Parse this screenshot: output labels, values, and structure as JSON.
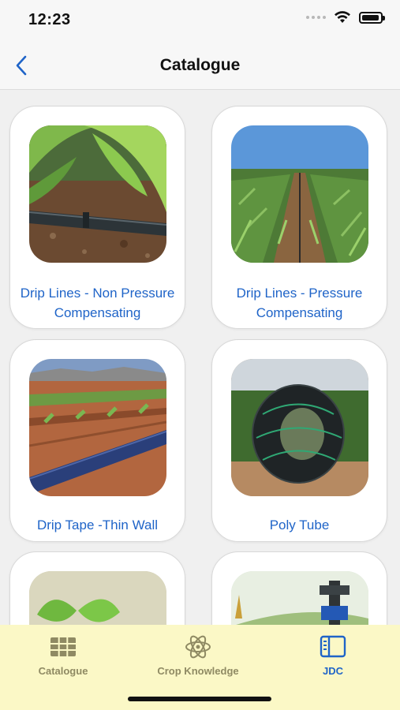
{
  "status_bar": {
    "time": "12:23"
  },
  "nav": {
    "title": "Catalogue",
    "back_icon": "chevron-left-icon"
  },
  "products": [
    {
      "label_line1": "Drip Lines - Non Pressure",
      "label_line2": "Compensating",
      "image": "drip-lines-leaf-photo"
    },
    {
      "label_line1": "Drip Lines - Pressure",
      "label_line2": "Compensating",
      "image": "corn-field-drip-line-photo"
    },
    {
      "label_line1": "Drip Tape -Thin Wall",
      "label_line2": "",
      "image": "drip-tape-field-photo"
    },
    {
      "label_line1": "Poly Tube",
      "label_line2": "",
      "image": "poly-tube-coil-photo"
    },
    {
      "label_line1": "",
      "label_line2": "",
      "image": "seedling-photo"
    },
    {
      "label_line1": "",
      "label_line2": "",
      "image": "sprinkler-photo"
    }
  ],
  "tab_bar": {
    "tabs": [
      {
        "label": "Catalogue",
        "icon": "grid-icon",
        "active": false
      },
      {
        "label": "Crop Knowledge",
        "icon": "atom-icon",
        "active": false
      },
      {
        "label": "JDC",
        "icon": "sidebar-panel-icon",
        "active": true
      }
    ]
  },
  "colors": {
    "accent": "#1f64c8",
    "tab_bar_bg": "#fbf8c6",
    "tab_inactive": "#8f8a63",
    "page_bg": "#f0f0f0"
  }
}
